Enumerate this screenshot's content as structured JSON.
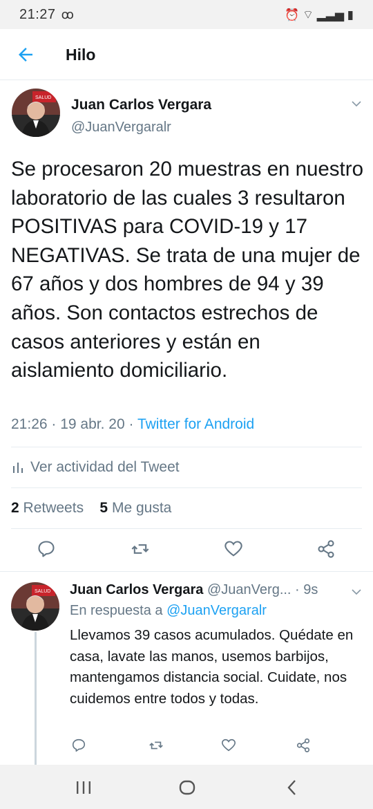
{
  "status": {
    "time": "21:27",
    "vm": "ꝏ",
    "icons": "⏰ ⌔ ▂▃▅ ▮"
  },
  "header": {
    "title": "Hilo"
  },
  "tweet": {
    "name": "Juan Carlos Vergara",
    "handle": "@JuanVergaralr",
    "text": "Se procesaron 20 muestras en nuestro laboratorio de las cuales 3 resultaron POSITIVAS para COVID-19 y 17 NEGATIVAS. Se trata de una mujer de 67 años y dos hombres de 94 y 39 años. Son contactos estrechos de casos anteriores y están en aislamiento domiciliario.",
    "time": "21:26",
    "date": "19 abr. 20",
    "client": "Twitter for Android",
    "activity": "Ver actividad del Tweet",
    "retweets_count": "2",
    "retweets_label": "Retweets",
    "likes_count": "5",
    "likes_label": "Me gusta"
  },
  "reply": {
    "name": "Juan Carlos Vergara",
    "handle": "@JuanVerg...",
    "age": "· 9s",
    "in_reply_prefix": "En respuesta a",
    "in_reply_handle": "@JuanVergaralr",
    "text": "Llevamos 39 casos acumulados. Quédate en casa, lavate las manos, usemos barbijos, mantengamos distancia social. Cuidate, nos cuidemos entre todos y todas."
  },
  "avatar_badge": "SALUD",
  "colors": {
    "accent": "#1da1f2",
    "text": "#14171a",
    "muted": "#657786"
  },
  "icons": [
    "back-arrow-icon",
    "chevron-down-icon",
    "reply-icon",
    "retweet-icon",
    "like-icon",
    "share-icon",
    "bar-chart-icon"
  ]
}
